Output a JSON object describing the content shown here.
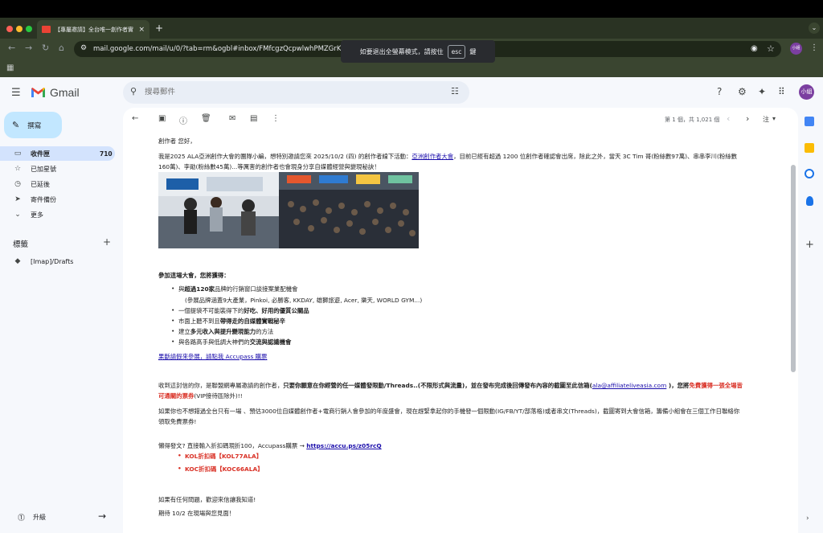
{
  "browser": {
    "tab_title": "【專屬邀請】全台唯一創作者實",
    "tab_close": "×",
    "new_tab": "+",
    "url": "mail.google.com/mail/u/0/?tab=rm&ogbl#inbox/FMfcgzQcpwlwhPMZGrKPv",
    "profile_initials": "小組",
    "fullscreen_toast": {
      "before": "如要退出全螢幕模式，請按住",
      "key": "esc",
      "after": "鍵"
    }
  },
  "gmail": {
    "brand": "Gmail",
    "search_placeholder": "搜尋郵件",
    "avatar": "小組",
    "compose": "撰寫",
    "nav": [
      {
        "label": "收件匣",
        "count": "710",
        "icon": "inbox-icon"
      },
      {
        "label": "已加星號",
        "icon": "star-icon"
      },
      {
        "label": "已延後",
        "icon": "clock-icon"
      },
      {
        "label": "寄件備份",
        "icon": "send-icon"
      },
      {
        "label": "更多",
        "icon": "chevron-down-icon"
      }
    ],
    "labels_title": "標籤",
    "labels": [
      {
        "label": "[Imap]/Drafts"
      }
    ],
    "upgrade": "升級",
    "pager": "第 1 個，共 1,021 個",
    "lang": "注"
  },
  "email": {
    "greeting": "創作者 您好，",
    "intro_1a": "我是2025 ALA亞洲創作大會的團隊小編，想特別邀請您來 2025/10/2 (四) 的創作者線下活動：",
    "intro_link": "亞洲創作者大會",
    "intro_1b": "，目前已經有超過 1200 位創作者確認會出席，除此之外，當天 3C Tim 哥(粉絲數97萬)、串串李川(粉絲數",
    "intro_2": "160萬)、李勛(粉絲數45萬)...等厲害的創作者也會現身分享自媒體經營與變現秘訣！",
    "benefits_title": "參加這場大會，您將獲得：",
    "benefits": [
      {
        "pre": "與",
        "bold": "超過120家",
        "post": "品牌的行銷窗口談接案業配機會"
      },
      {
        "pre": "(參展品牌涵蓋9大產業，Pinkoi, 必勝客, KKDAY, 雄獅旅遊, Acer, 樂天, WORLD GYM...)",
        "bold": "",
        "post": ""
      },
      {
        "pre": "一個提袋不可能裝得下的",
        "bold": "好吃、好用的優質公關品",
        "post": ""
      },
      {
        "pre": "市面上聽不到且",
        "bold": "帶得走的自媒體實戰秘辛",
        "post": ""
      },
      {
        "pre": "建立",
        "bold": "多元收入與提升變現能力",
        "post": "的方法"
      },
      {
        "pre": "與各路高手與低調大神們的",
        "bold": "交流與認識機會",
        "post": ""
      }
    ],
    "leave_link": "果斷請假來參展，請點我 Accupass 購票",
    "p2_1a": "收到這封信的你，是聯盟網專屬邀請的創作者，",
    "p2_1b": "只要你願意在你經營的任一媒體發限動/Threads..(不限形式與流量)，並在發布完成後回傳發布內容的截圖至此信箱(",
    "p2_email": "ala@affiliateliveasia.com",
    "p2_1c": " )，您將",
    "p2_1d": "免費獲得一張全場皆",
    "p2_2a": "可通關的票券",
    "p2_2b": "(VIP接待區除外)!!",
    "p3_1": "如果你也不想錯過全台只有一場 、預估3000位自媒體創作者+電商行銷人會參加的年度盛會，現在趕緊拿起你的手機發一個限動(IG/FB/YT/部落格)或者串文(Threads)，截圖寄到大會信箱，籌備小組會在三個工作日聯絡你",
    "p3_2": "領取免費票券!",
    "lazy": "懶得發文? 直接輸入折扣碼現折100，Accupass購票 → ",
    "lazy_link": "https://accu.ps/z05rcQ",
    "codes": [
      "KOL折扣碼【KOL77ALA】",
      "KOC折扣碼【KOC66ALA】"
    ],
    "closing_1": "如果有任何問題，歡迎來信讓我知道!",
    "closing_2": "期待 10/2 在現場與您見面！"
  }
}
